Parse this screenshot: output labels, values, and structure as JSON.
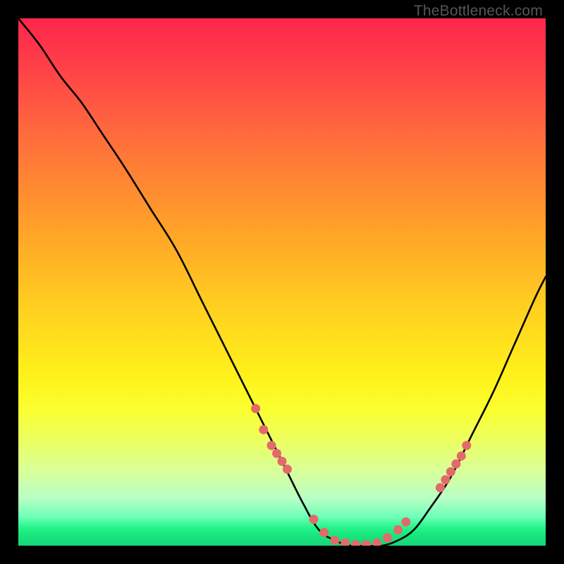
{
  "watermark": "TheBottleneck.com",
  "colors": {
    "curve": "#000000",
    "dot_fill": "#e26a6a",
    "dot_stroke": "#c24e4e"
  },
  "chart_data": {
    "type": "line",
    "title": "",
    "xlabel": "",
    "ylabel": "",
    "xlim": [
      0,
      100
    ],
    "ylim": [
      0,
      100
    ],
    "curve": {
      "x": [
        0,
        4,
        8,
        12,
        16,
        20,
        25,
        30,
        35,
        40,
        45,
        50,
        54,
        57,
        60,
        63,
        66,
        69,
        72,
        75,
        78,
        82,
        86,
        90,
        94,
        98,
        100
      ],
      "y": [
        100,
        95,
        89,
        84,
        78,
        72,
        64,
        56,
        46,
        36,
        26,
        16,
        8,
        3,
        1,
        0,
        0,
        0,
        1,
        3,
        7,
        13,
        21,
        29,
        38,
        47,
        51
      ]
    },
    "dots": {
      "x": [
        45,
        46.5,
        48,
        49,
        50,
        51,
        56,
        58,
        60,
        62,
        64,
        66,
        68,
        70,
        72,
        73.5,
        80,
        81,
        82,
        83,
        84,
        85
      ],
      "y": [
        26,
        22,
        19,
        17.5,
        16,
        14.5,
        5,
        2.5,
        1,
        0.5,
        0.2,
        0.2,
        0.5,
        1.5,
        3,
        4.5,
        11,
        12.5,
        14,
        15.5,
        17,
        19
      ]
    },
    "dot_radius": 6.5
  }
}
